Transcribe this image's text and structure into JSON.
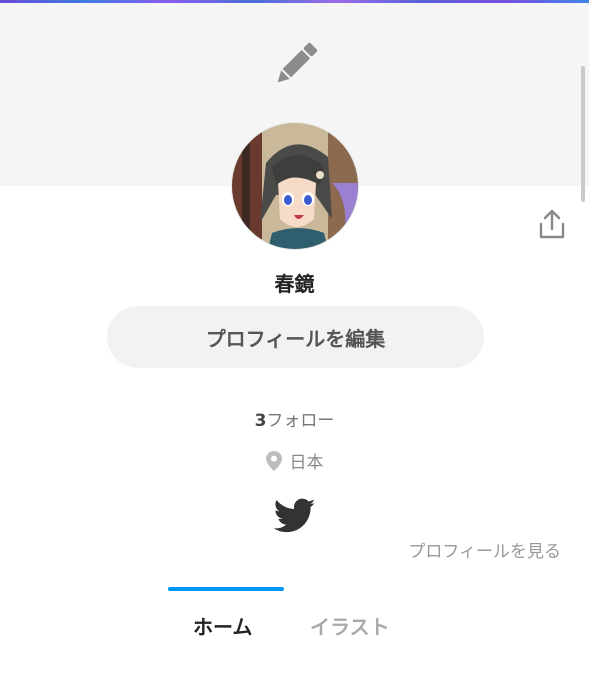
{
  "profile": {
    "name": "春鏡",
    "edit_button": "プロフィールを編集",
    "follow_count": "3",
    "follow_label": "フォロー",
    "location": "日本",
    "see_profile": "プロフィールを見る"
  },
  "tabs": [
    {
      "label": "ホーム",
      "active": true
    },
    {
      "label": "イラスト",
      "active": false
    }
  ],
  "icons": {
    "cover_edit": "pencil-icon",
    "share": "share-icon",
    "location": "location-pin-icon",
    "twitter": "twitter-icon"
  },
  "colors": {
    "accent": "#0096fa",
    "cover_bg": "#f5f5f5",
    "button_bg": "#f2f2f2"
  }
}
